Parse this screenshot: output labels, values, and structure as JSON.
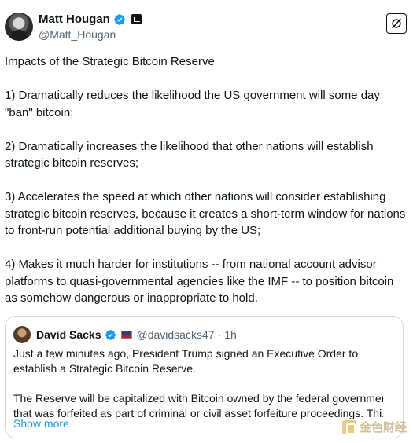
{
  "author": {
    "display_name": "Matt Hougan",
    "handle": "@Matt_Hougan"
  },
  "post": {
    "paragraphs": [
      "Impacts of the Strategic Bitcoin Reserve",
      "1) Dramatically reduces the likelihood the US government will some day \"ban\" bitcoin;",
      "2) Dramatically increases the likelihood that other nations will establish strategic bitcoin reserves;",
      "3) Accelerates the speed at which other nations will consider establishing strategic bitcoin reserves, because it creates a short-term window for nations to front-run potential additional buying by the US;",
      "4) Makes it much harder for institutions -- from national account advisor platforms to quasi-governmental agencies like the IMF -- to position bitcoin as somehow dangerous or inappropriate to hold."
    ]
  },
  "quote": {
    "display_name": "David Sacks",
    "handle": "@davidsacks47",
    "separator": "·",
    "time": "1h",
    "paragraph_1": "Just a few minutes ago, President Trump signed an Executive Order to establish a Strategic Bitcoin Reserve.",
    "paragraph_2_line_1": "The Reserve will be capitalized with Bitcoin owned by the federal government",
    "paragraph_2_line_2": "that was forfeited as part of criminal or civil asset forfeiture proceedings. Thi...",
    "show_more": "Show more"
  },
  "watermark": {
    "text": "金色财经"
  },
  "icons": {
    "verified": "verified-badge-icon",
    "affiliation": "affiliation-badge-icon",
    "grok": "grok-icon"
  },
  "colors": {
    "verified_blue": "#1d9bf0",
    "text": "#0f1419",
    "secondary": "#536471",
    "border": "#cfd9de"
  }
}
